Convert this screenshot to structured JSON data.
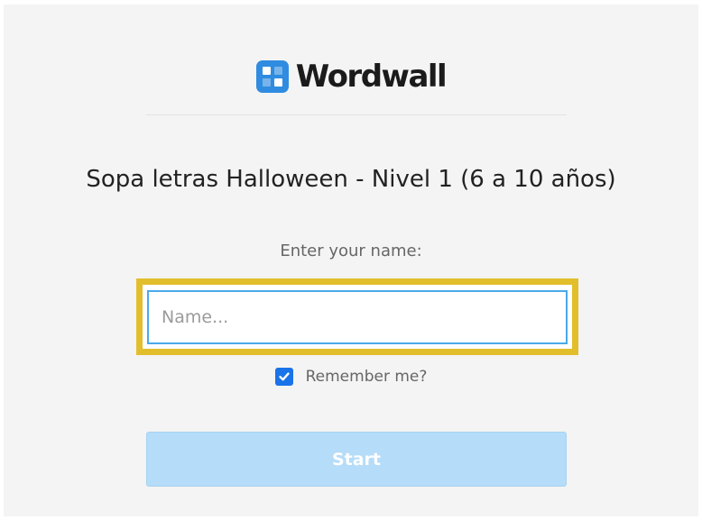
{
  "brand": {
    "name": "Wordwall",
    "logo_icon": "wordwall-grid-icon",
    "logo_color": "#2f8ce0"
  },
  "activity": {
    "title": "Sopa letras Halloween - Nivel 1 (6 a 10 años)"
  },
  "form": {
    "prompt": "Enter your name:",
    "name_placeholder": "Name...",
    "name_value": "",
    "remember_label": "Remember me?",
    "remember_checked": true,
    "start_label": "Start"
  },
  "colors": {
    "highlight_border": "#e3be2c",
    "input_border": "#4aa9ea",
    "checkbox": "#1a73e8",
    "start_button_bg": "#b5dcf8"
  }
}
